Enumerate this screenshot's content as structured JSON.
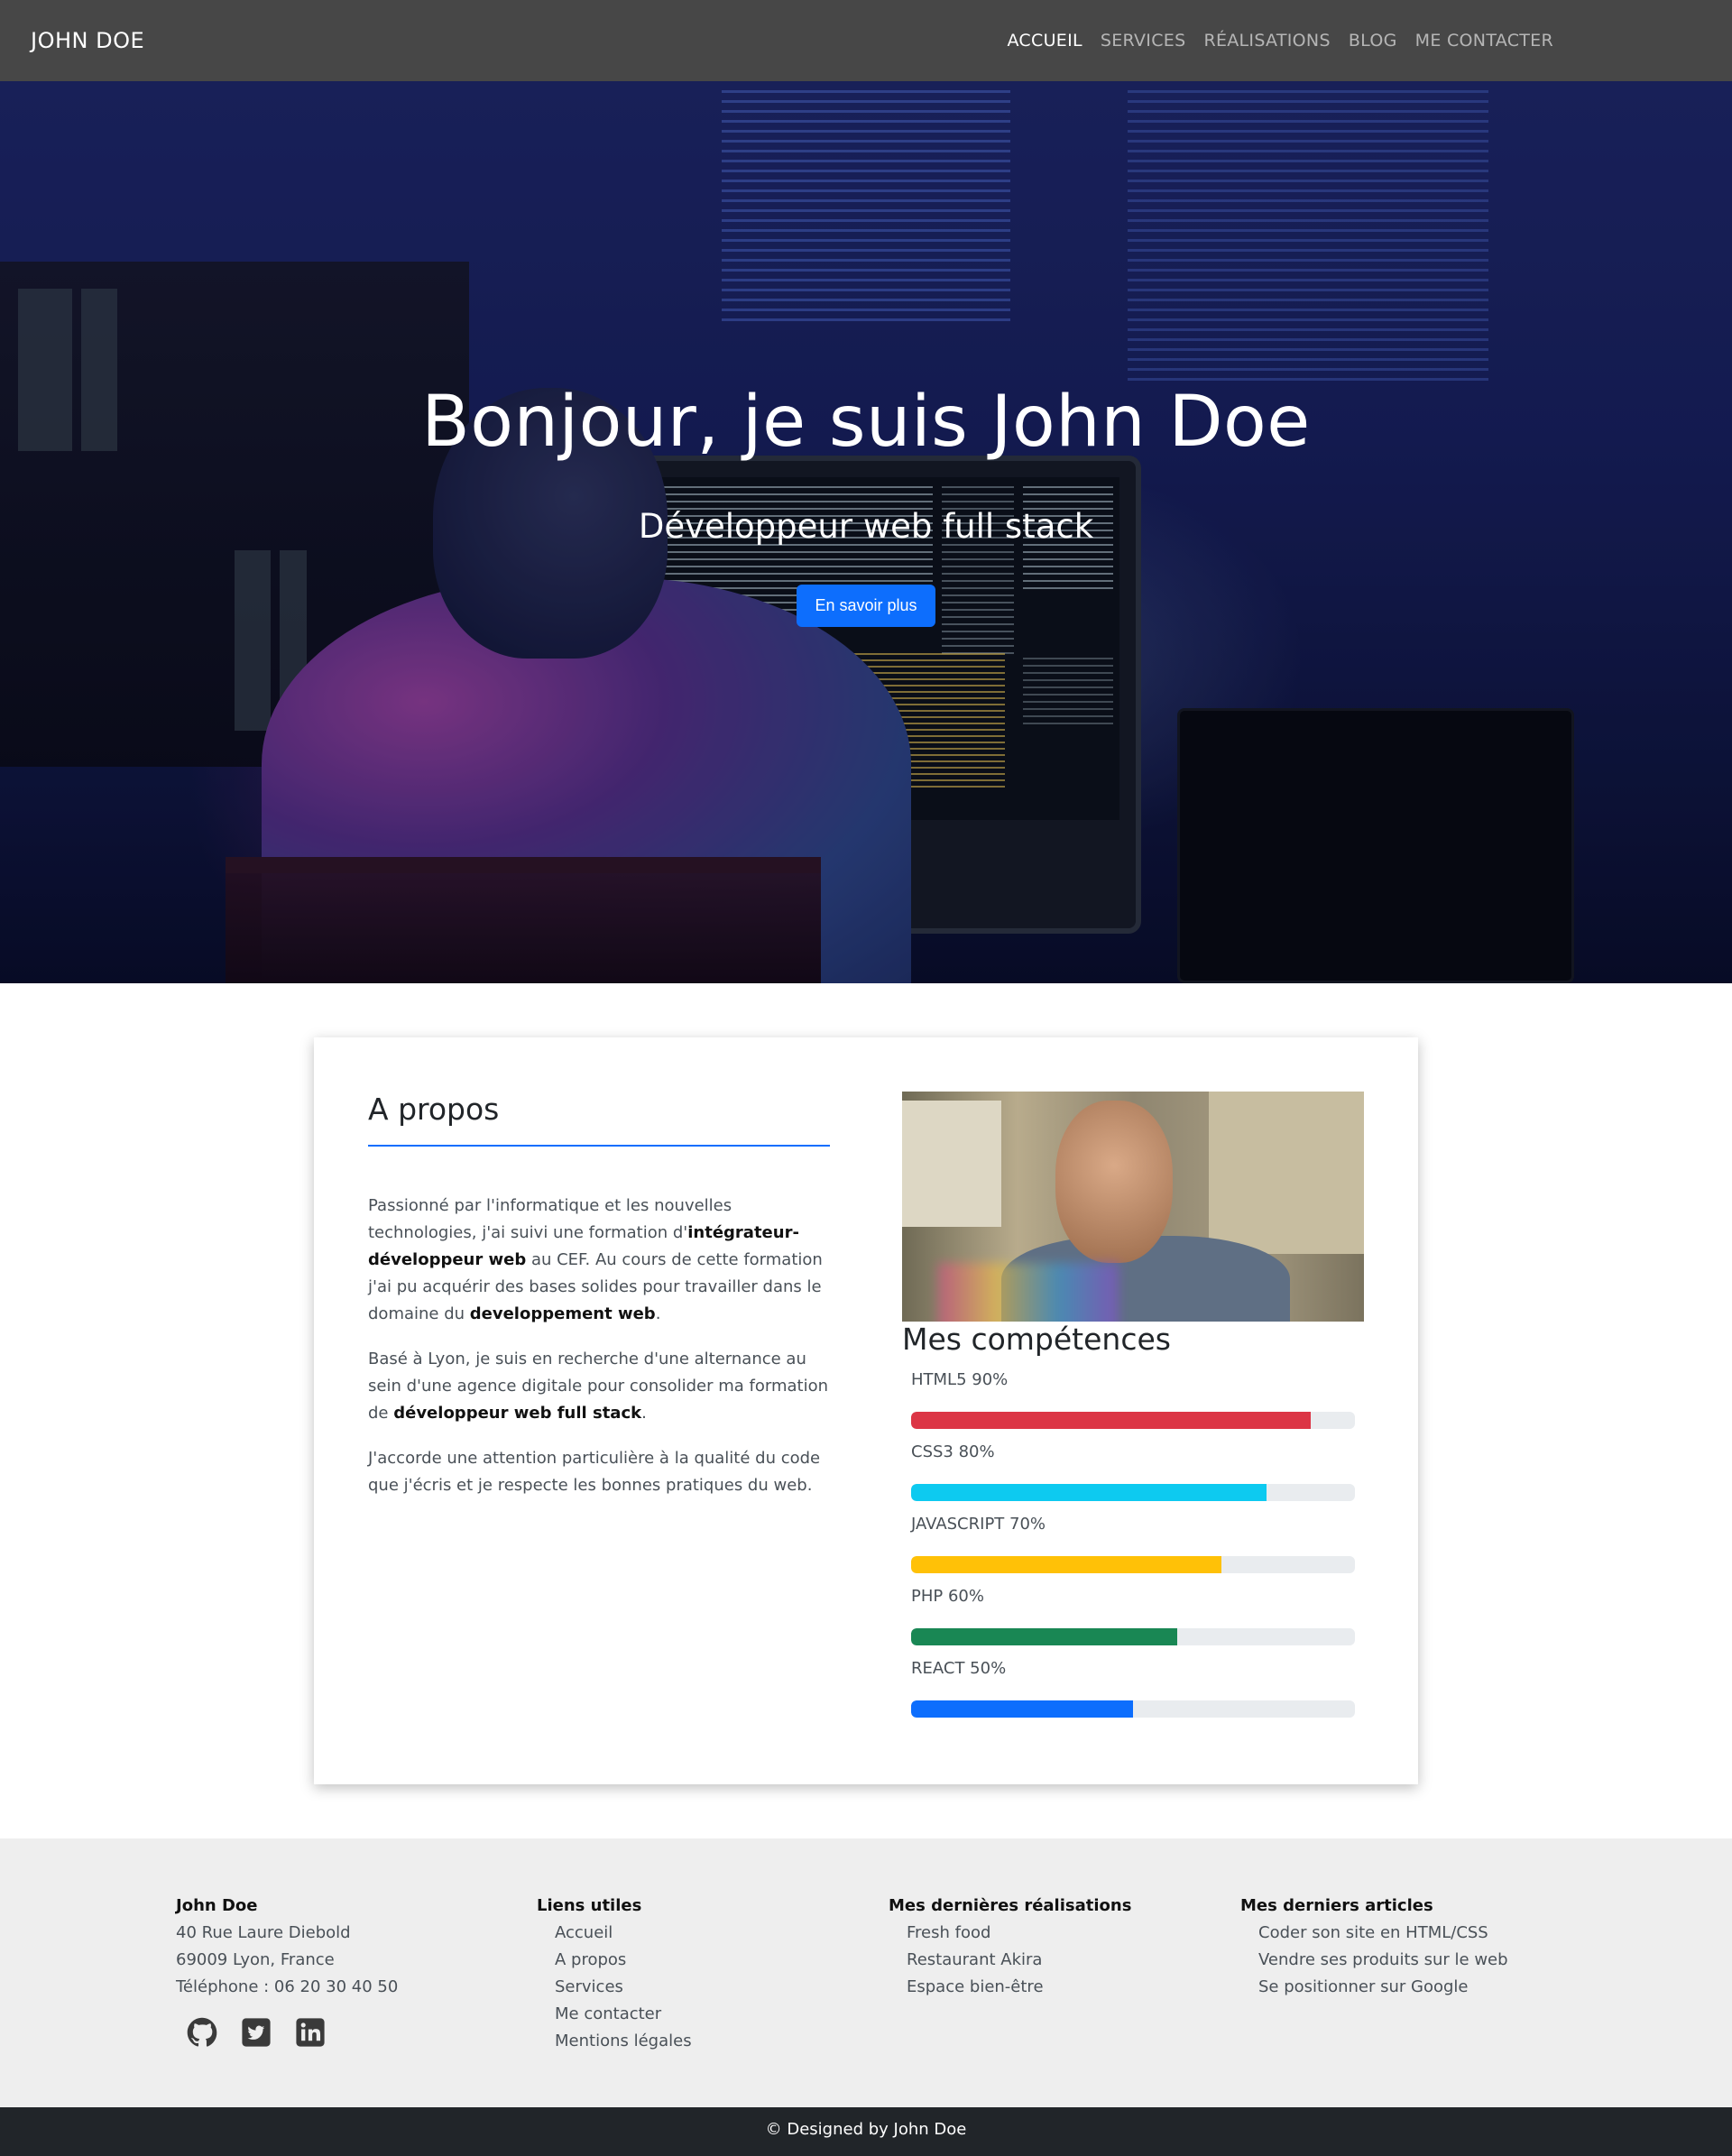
{
  "nav": {
    "brand": "JOHN DOE",
    "items": [
      {
        "label": "ACCUEIL",
        "active": true
      },
      {
        "label": "SERVICES",
        "active": false
      },
      {
        "label": "RÉALISATIONS",
        "active": false
      },
      {
        "label": "BLOG",
        "active": false
      },
      {
        "label": "ME CONTACTER",
        "active": false
      }
    ]
  },
  "hero": {
    "title": "Bonjour, je suis John Doe",
    "subtitle": "Développeur web full stack",
    "button": "En savoir plus"
  },
  "about": {
    "title": "A propos",
    "paragraphs": [
      [
        "Passionné par l'informatique et les nouvelles technologies, j'ai suivi une formation d'",
        "intégrateur-développeur web",
        " au CEF. Au cours de cette formation j'ai pu acquérir des bases solides pour travailler dans le domaine du ",
        "developpement web",
        "."
      ],
      [
        "Basé à Lyon, je suis en recherche d'une alternance au sein d'une agence digitale pour consolider ma formation de ",
        "développeur web full stack",
        "."
      ],
      [
        "J'accorde une attention particulière à la qualité du code que j'écris et je respecte les bonnes pratiques du web."
      ]
    ]
  },
  "skills": {
    "title": "Mes compétences",
    "items": [
      {
        "label": "HTML5 90%",
        "value": 90,
        "color": "#dc3545"
      },
      {
        "label": "CSS3 80%",
        "value": 80,
        "color": "#0dcaf0"
      },
      {
        "label": "JAVASCRIPT 70%",
        "value": 70,
        "color": "#ffc107"
      },
      {
        "label": "PHP 60%",
        "value": 60,
        "color": "#198754"
      },
      {
        "label": "REACT 50%",
        "value": 50,
        "color": "#0d6efd"
      }
    ]
  },
  "footer": {
    "contact": {
      "title": "John Doe",
      "lines": [
        "40 Rue Laure Diebold",
        "69009 Lyon, France",
        "Téléphone : 06 20 30 40 50"
      ],
      "socials": [
        "github-icon",
        "twitter-icon",
        "linkedin-icon"
      ]
    },
    "links": {
      "title": "Liens utiles",
      "items": [
        "Accueil",
        "A propos",
        "Services",
        "Me contacter",
        "Mentions légales"
      ]
    },
    "works": {
      "title": "Mes dernières réalisations",
      "items": [
        "Fresh food",
        "Restaurant Akira",
        "Espace bien-être"
      ]
    },
    "articles": {
      "title": "Mes derniers articles",
      "items": [
        "Coder son site en HTML/CSS",
        "Vendre ses produits sur le web",
        "Se positionner sur Google"
      ]
    }
  },
  "copyright": "© Designed by John Doe",
  "colors": {
    "navbar": "#474747",
    "accent": "#0d6efd",
    "footer": "#eeeeee",
    "copyright_bar": "#212529"
  }
}
